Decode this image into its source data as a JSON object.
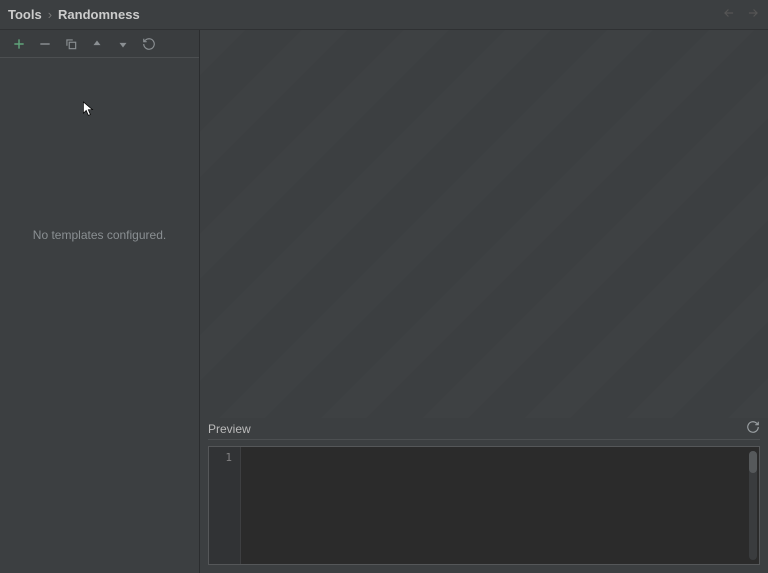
{
  "breadcrumb": {
    "root": "Tools",
    "sep": "›",
    "current": "Randomness"
  },
  "sidebar": {
    "empty_label": "No templates configured."
  },
  "preview": {
    "title": "Preview",
    "gutter_line": "1"
  }
}
